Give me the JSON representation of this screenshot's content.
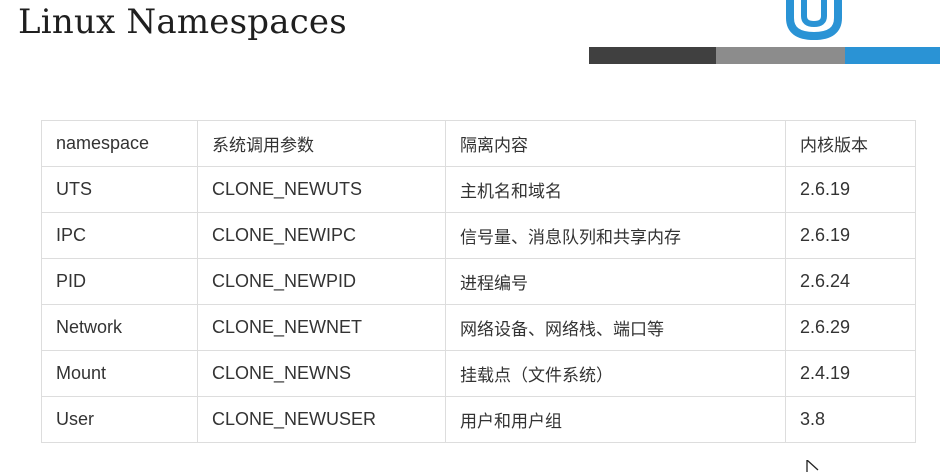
{
  "slide": {
    "title": "Linux Namespaces"
  },
  "logo": {
    "icon": "logo-mark-icon",
    "brand_color": "#2a93d5"
  },
  "colors": {
    "stripe_dark": "#404040",
    "stripe_mid": "#8c8c8c",
    "stripe_blue": "#2a93d5",
    "table_border": "#dddddd",
    "text": "#333333"
  },
  "table": {
    "headers": [
      "namespace",
      "系统调用参数",
      "隔离内容",
      "内核版本"
    ],
    "rows": [
      [
        "UTS",
        "CLONE_NEWUTS",
        "主机名和域名",
        "2.6.19"
      ],
      [
        "IPC",
        "CLONE_NEWIPC",
        "信号量、消息队列和共享内存",
        "2.6.19"
      ],
      [
        "PID",
        "CLONE_NEWPID",
        "进程编号",
        "2.6.24"
      ],
      [
        "Network",
        "CLONE_NEWNET",
        "网络设备、网络栈、端口等",
        "2.6.29"
      ],
      [
        "Mount",
        "CLONE_NEWNS",
        "挂载点（文件系统）",
        "2.4.19"
      ],
      [
        "User",
        "CLONE_NEWUSER",
        "用户和用户组",
        "3.8"
      ]
    ]
  }
}
